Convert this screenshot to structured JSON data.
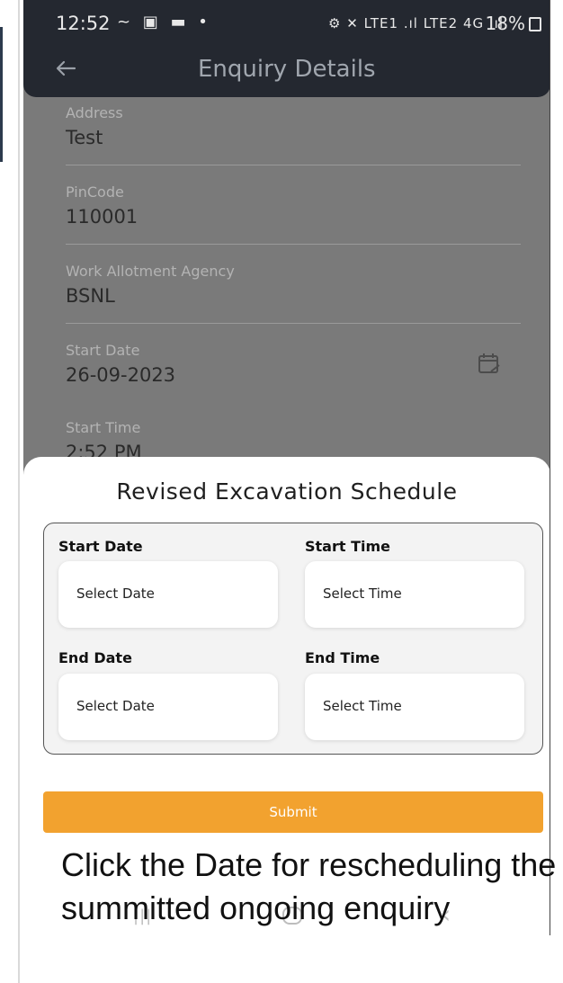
{
  "status_bar": {
    "time": "12:52",
    "left_icons": "~ ▣ ▬ •",
    "right_icons": "⚙ ✕ LTE1 .ıl LTE2 4G .ıl",
    "battery": "18%"
  },
  "app_bar": {
    "back_icon": "arrow-left-icon",
    "title": "Enquiry Details"
  },
  "details": [
    {
      "label": "Address",
      "value": "Test"
    },
    {
      "label": "PinCode",
      "value": "110001"
    },
    {
      "label": "Work Allotment Agency",
      "value": "BSNL"
    },
    {
      "label": "Start Date",
      "value": "26-09-2023"
    },
    {
      "label": "Start Time",
      "value": "2:52 PM"
    }
  ],
  "sheet": {
    "title": "Revised Excavation Schedule",
    "start_date_label": "Start Date",
    "start_date_value": "Select Date",
    "start_time_label": "Start Time",
    "start_time_value": "Select Time",
    "end_date_label": "End Date",
    "end_date_value": "Select Date",
    "end_time_label": "End Time",
    "end_time_value": "Select Time",
    "submit_label": "Submit"
  },
  "caption": "Click the Date for rescheduling the summitted ongoing enquiry",
  "colors": {
    "accent": "#f2a22f",
    "app_bar": "#242830",
    "overlay": "#7a7a7a"
  }
}
